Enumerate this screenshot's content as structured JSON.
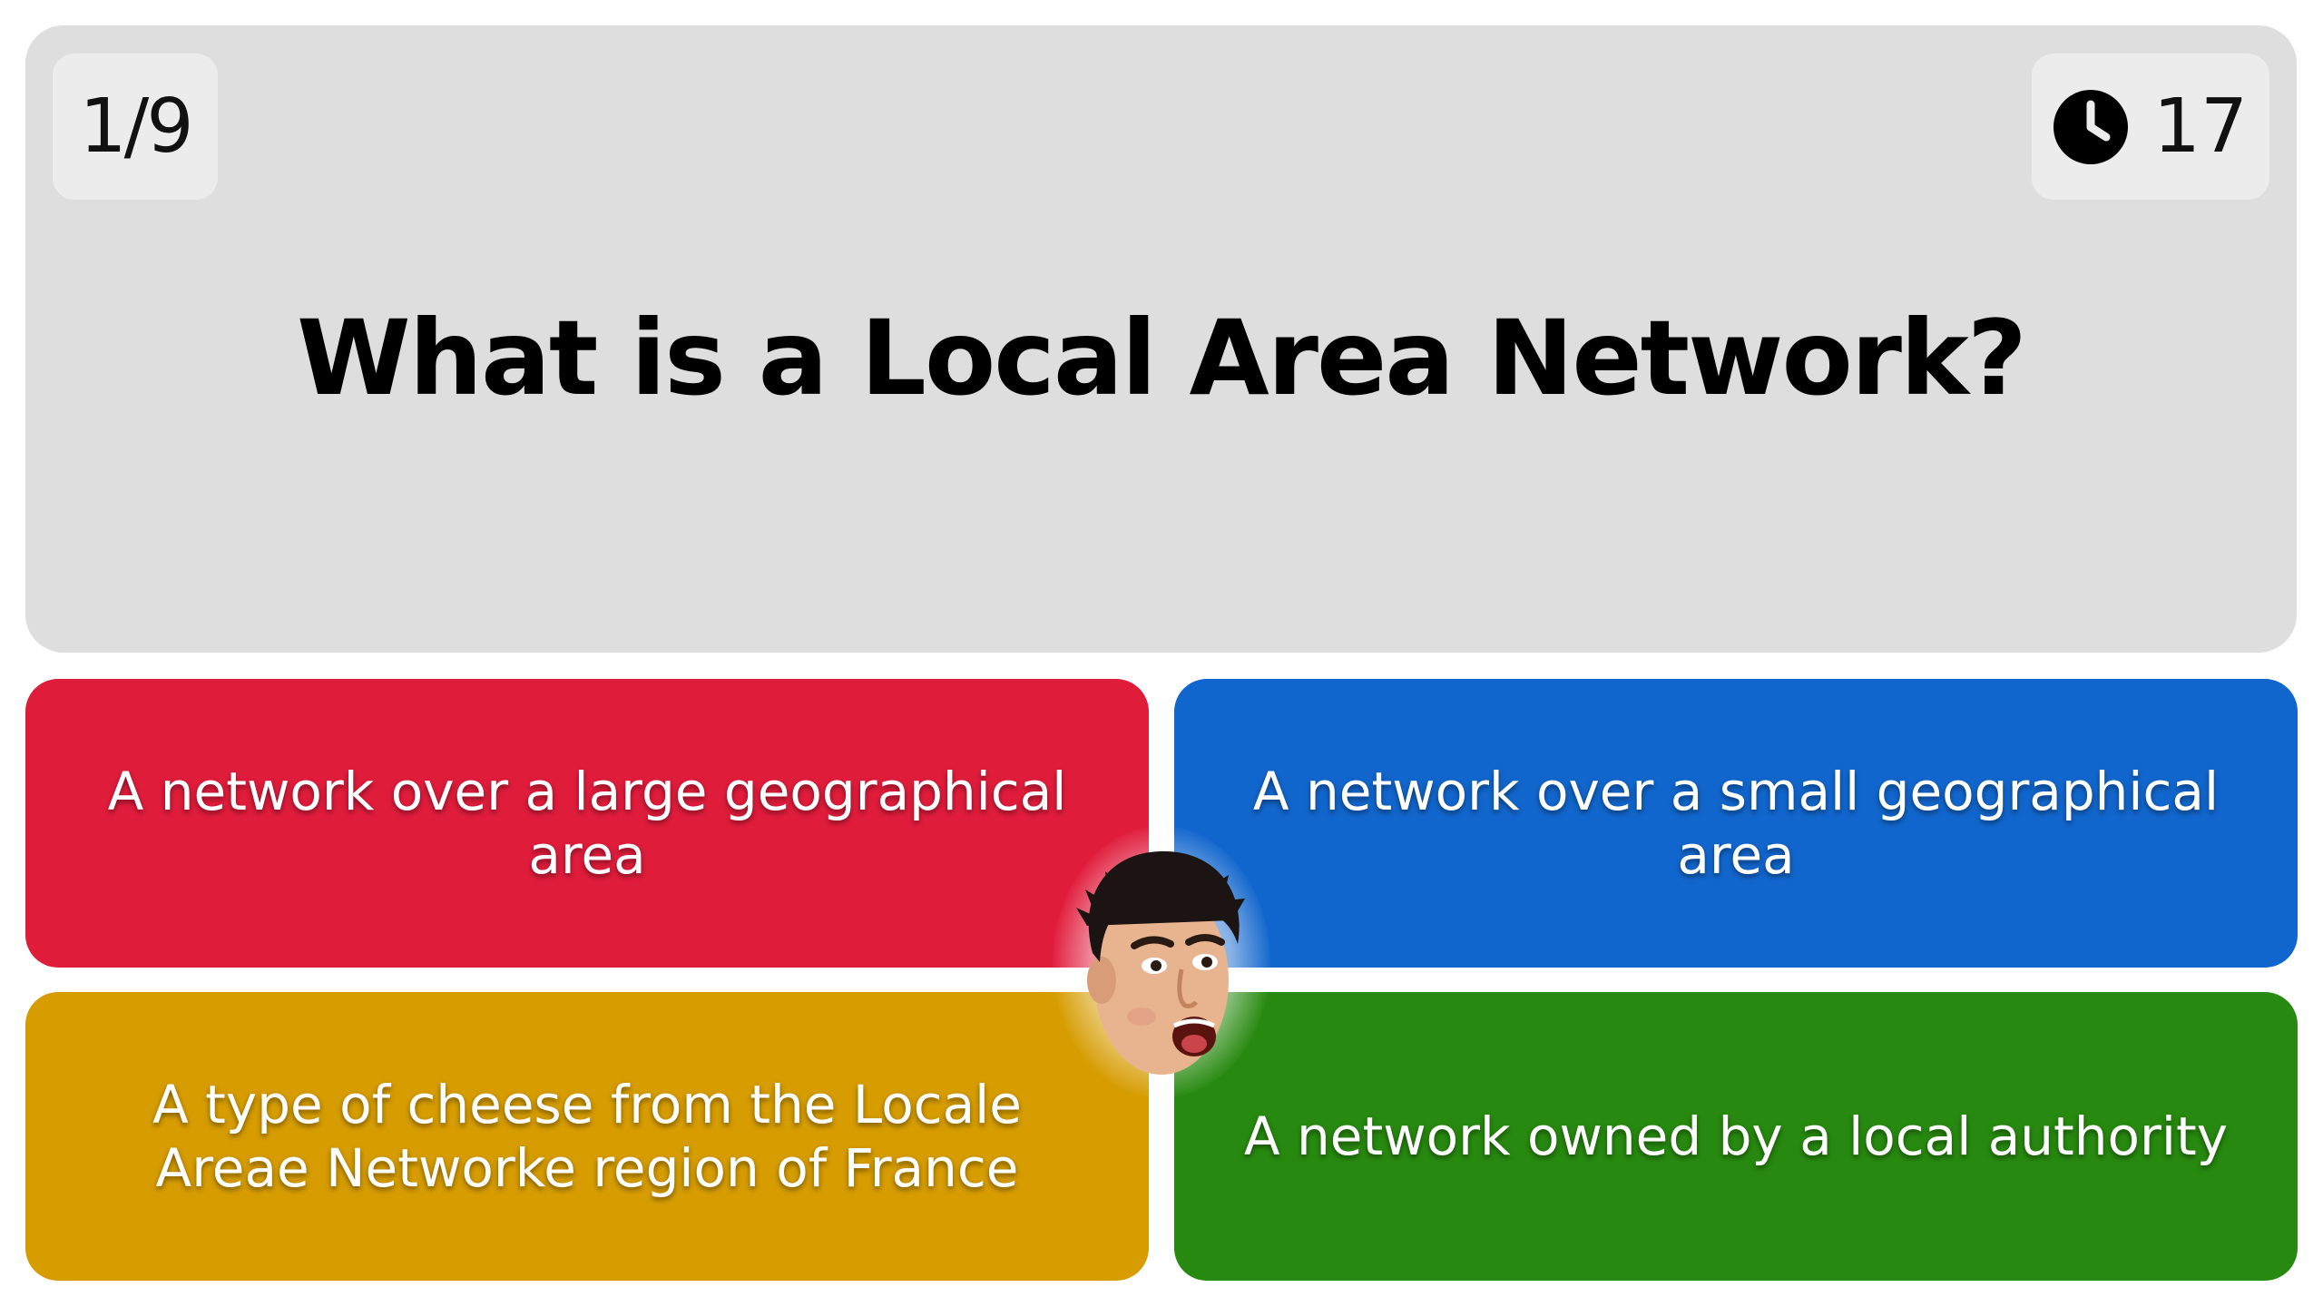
{
  "quiz": {
    "progress": "1/9",
    "timer": "17",
    "question": "What is a Local Area Network?",
    "answers": [
      {
        "text": "A network over a large geographical area",
        "color": "#e01c3b"
      },
      {
        "text": "A network over a small geographical area",
        "color": "#1166cd"
      },
      {
        "text": "A type of cheese from the Locale Areae Networke region of France",
        "color": "#d69c00"
      },
      {
        "text": "A network owned by a local authority",
        "color": "#27890f"
      }
    ]
  },
  "icons": {
    "timer": "clock-icon",
    "overlay": "surprised-face-emote"
  },
  "colors": {
    "question_card": "#dedede",
    "pill_background": "#ececec"
  }
}
